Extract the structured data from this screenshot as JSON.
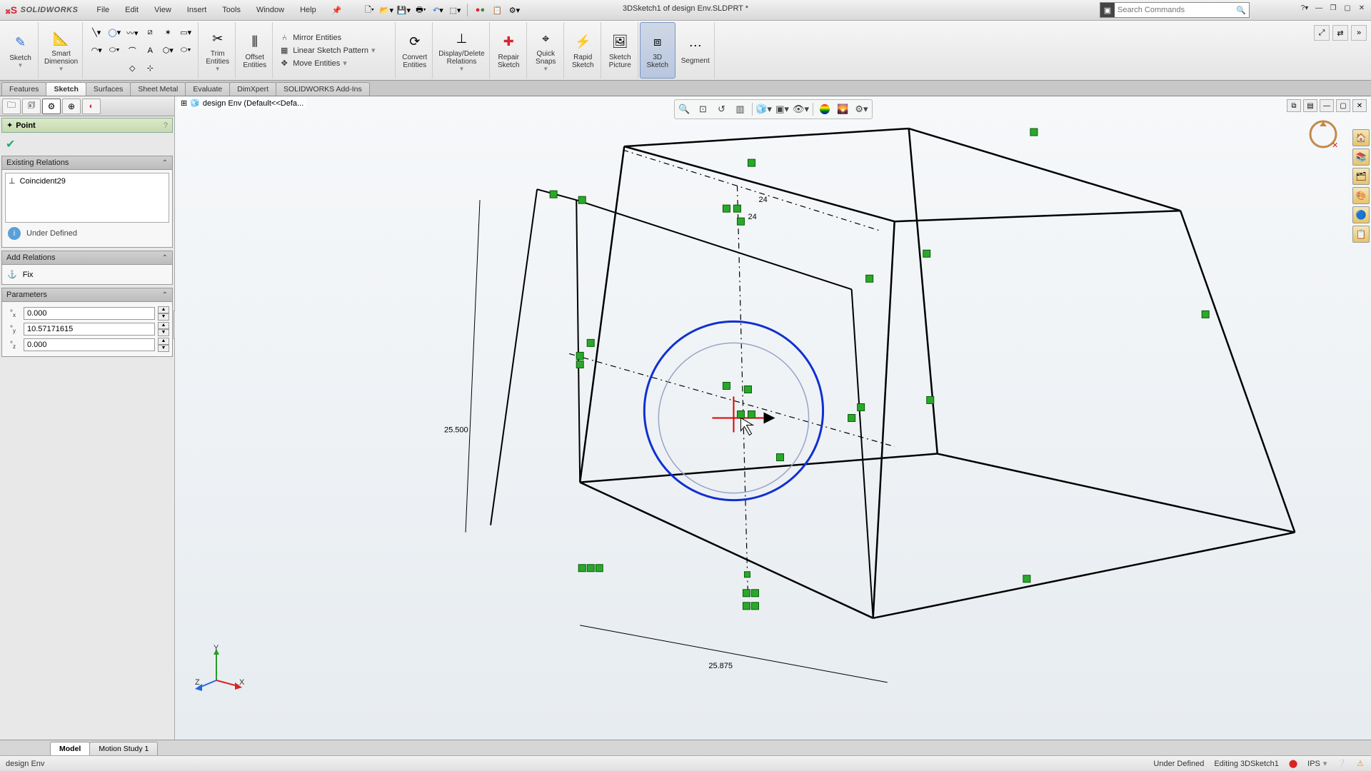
{
  "app": {
    "name": "SOLIDWORKS",
    "doc_title": "3DSketch1 of design Env.SLDPRT *"
  },
  "menus": [
    "File",
    "Edit",
    "View",
    "Insert",
    "Tools",
    "Window",
    "Help"
  ],
  "search": {
    "placeholder": "Search Commands"
  },
  "ribbon": {
    "sketch": "Sketch",
    "smart_dim": "Smart\nDimension",
    "trim": "Trim\nEntities",
    "offset": "Offset\nEntities",
    "convert": "Convert\nEntities",
    "display_delete": "Display/Delete\nRelations",
    "repair": "Repair\nSketch",
    "quick_snaps": "Quick\nSnaps",
    "rapid": "Rapid\nSketch",
    "picture": "Sketch\nPicture",
    "sketch3d": "3D\nSketch",
    "segment": "Segment",
    "mirror": "Mirror Entities",
    "linear_pattern": "Linear Sketch Pattern",
    "move": "Move Entities"
  },
  "ftabs": [
    "Features",
    "Sketch",
    "Surfaces",
    "Sheet Metal",
    "Evaluate",
    "DimXpert",
    "SOLIDWORKS Add-Ins"
  ],
  "ftab_active": "Sketch",
  "breadcrumb": "design Env  (Default<<Defa...",
  "panel": {
    "title": "Point",
    "existing": {
      "header": "Existing Relations",
      "items": [
        "Coincident29"
      ],
      "status": "Under Defined"
    },
    "add": {
      "header": "Add Relations",
      "fix": "Fix"
    },
    "params": {
      "header": "Parameters",
      "x": "0.000",
      "y": "10.57171615",
      "z": "0.000"
    }
  },
  "dims": {
    "height": "25.500",
    "width": "25.875",
    "small1": "24",
    "small2": "24"
  },
  "btabs": [
    "Model",
    "Motion Study 1"
  ],
  "btab_active": "Model",
  "status": {
    "left": "design Env",
    "def": "Under Defined",
    "editing": "Editing 3DSketch1",
    "units": "IPS"
  }
}
